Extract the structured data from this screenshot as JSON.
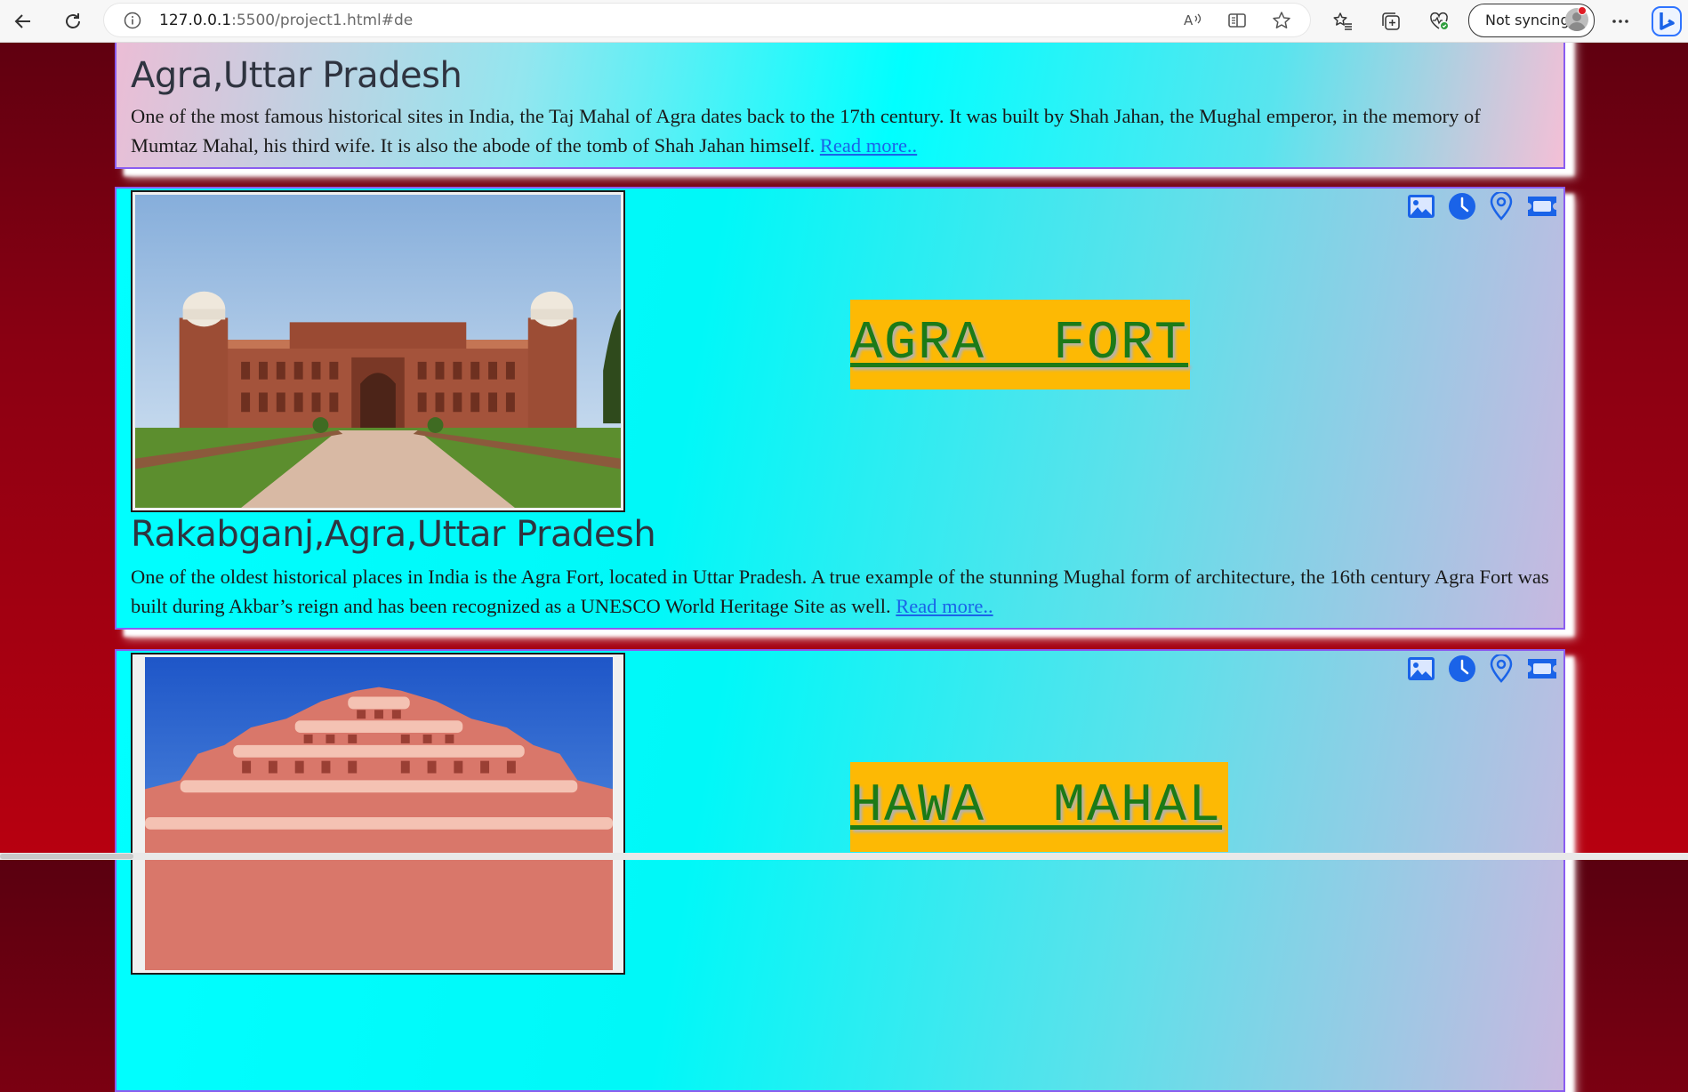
{
  "browser": {
    "url_host": "127.0.0.1",
    "url_rest": ":5500/project1.html#de",
    "sync_label": "Not syncing"
  },
  "cards": [
    {
      "location": "Agra,Uttar Pradesh",
      "description": "One of the most famous historical sites in India, the Taj Mahal of Agra dates back to the 17th century. It was built by Shah Jahan, the Mughal emperor, in the memory of Mumtaz Mahal, his third wife. It is also the abode of the tomb of Shah Jahan himself.",
      "read_more": "Read more.."
    },
    {
      "title": "AGRA  FORT",
      "location": "Rakabganj,Agra,Uttar Pradesh",
      "description": "One of the oldest historical places in India is the Agra Fort, located in Uttar Pradesh. A true example of the stunning Mughal form of architecture, the 16th century Agra Fort was built during Akbar’s reign and has been recognized as a UNESCO World Heritage Site as well.",
      "read_more": "Read more.."
    },
    {
      "title": "HAWA  MAHAL"
    }
  ],
  "icons": [
    "image-icon",
    "clock-icon",
    "location-pin-icon",
    "ticket-icon"
  ],
  "colors": {
    "title_bg": "#fdb904",
    "title_text": "#1c7a17",
    "link": "#1a63e8",
    "icon": "#1a63e8",
    "card_border": "#8a5cf0",
    "page_bg": "#8a0012"
  }
}
